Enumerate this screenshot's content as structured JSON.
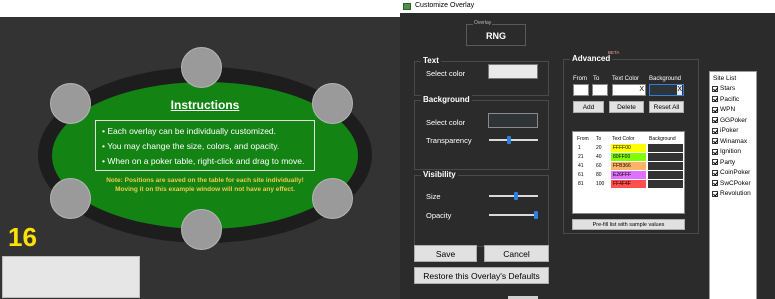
{
  "table": {
    "instructions_title": "Instructions",
    "instructions": [
      "Each overlay can be individually customized.",
      "You may change the size, colors, and opacity.",
      "When on a poker table, right-click and drag to move."
    ],
    "note_line1": "Note: Positions are saved on the table for each site individually!",
    "note_line2": "Moving it on this example window will not have any effect.",
    "seat_number": "16",
    "colors": {
      "felt": "#138313",
      "rim": "#1d1d1d",
      "background": "#333333",
      "seat": "#9a9a9a",
      "number": "#ffe100"
    }
  },
  "window": {
    "title": "Customize Overlay",
    "icon": "app-icon"
  },
  "overlay": {
    "legend": "Overlay",
    "name": "RNG"
  },
  "text_section": {
    "legend": "Text",
    "select_color_label": "Select color",
    "swatch_color": "#e9e9e9"
  },
  "background_section": {
    "legend": "Background",
    "select_color_label": "Select color",
    "swatch_color": "#2f3437",
    "transparency_label": "Transparency",
    "transparency_level": 0.4
  },
  "visibility_section": {
    "legend": "Visibility",
    "size_label": "Size",
    "size_level": 0.55,
    "opacity_label": "Opacity",
    "opacity_level": 1.0
  },
  "advanced": {
    "legend": "Advanced",
    "beta": "BETA",
    "col_from": "From",
    "col_to": "To",
    "col_text_color": "Text Color",
    "col_background": "Background",
    "clear_symbol": "X",
    "add_label": "Add",
    "delete_label": "Delete",
    "reset_all_label": "Reset All",
    "list_headers": {
      "from": "From",
      "to": "To",
      "text_color": "Text Color",
      "background": "Background"
    },
    "rows": [
      {
        "from": "1",
        "to": "20",
        "text_color": "FFFF00",
        "text_hex": "#ffff00",
        "bg_hex": "#333333"
      },
      {
        "from": "21",
        "to": "40",
        "text_color": "80FF00",
        "text_hex": "#80ff00",
        "bg_hex": "#333333"
      },
      {
        "from": "41",
        "to": "60",
        "text_color": "FFB366",
        "text_hex": "#ffb366",
        "bg_hex": "#333333"
      },
      {
        "from": "61",
        "to": "80",
        "text_color": "E26FFF",
        "text_hex": "#e26fff",
        "bg_hex": "#333333"
      },
      {
        "from": "81",
        "to": "100",
        "text_color": "FF4F4F",
        "text_hex": "#ff4f4f",
        "bg_hex": "#333333"
      }
    ],
    "prefill_label": "Pre-fill list with sample values"
  },
  "site_list": {
    "title": "Site List",
    "items": [
      "Stars",
      "Pacific",
      "WPN",
      "GGPoker",
      "iPoker",
      "Winamax",
      "Ignition",
      "Party",
      "CoinPoker",
      "SwCPoker",
      "Revolution"
    ]
  },
  "actions": {
    "save_label": "Save",
    "cancel_label": "Cancel",
    "restore_label": "Restore this Overlay's Defaults"
  }
}
